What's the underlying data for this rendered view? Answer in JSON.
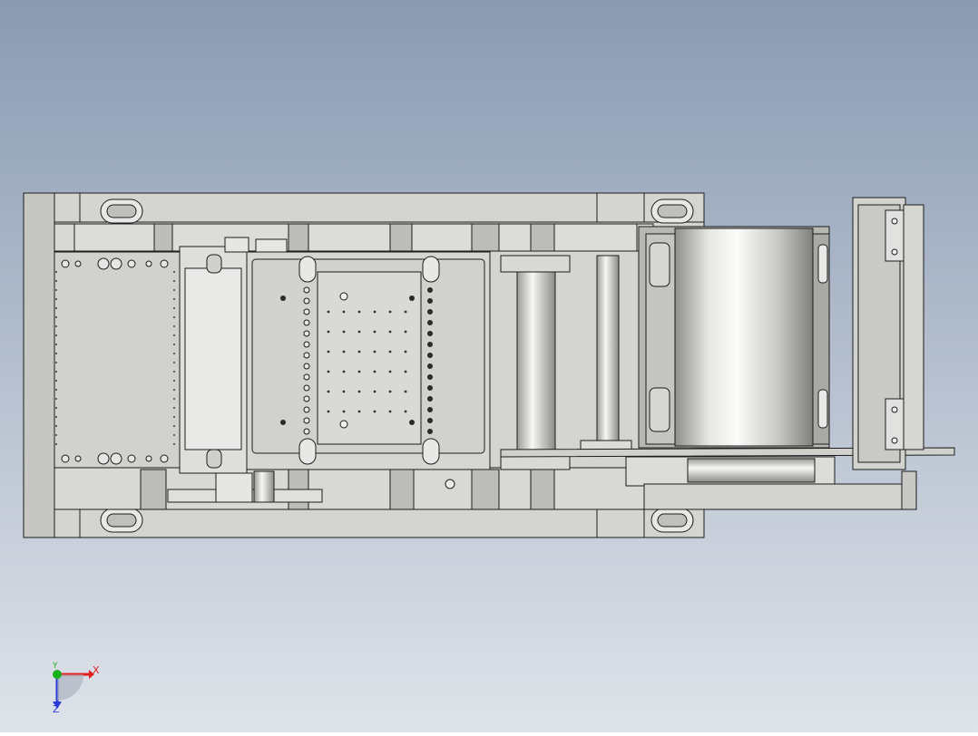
{
  "viewport": {
    "background_top": "#8a9bb2",
    "background_bottom": "#dfe3ea"
  },
  "model": {
    "body_color": "#cfd0cc",
    "edge_color": "#1c1c1c",
    "hole_color": "#2a2a2a",
    "highlight_color": "#f4f4f2",
    "shadow_color": "#8e8f8b"
  },
  "triad": {
    "x_label": "X",
    "y_label": "Y",
    "z_label": "Z",
    "x_color": "#e02020",
    "y_color": "#18b018",
    "z_color": "#2a3ad8"
  }
}
